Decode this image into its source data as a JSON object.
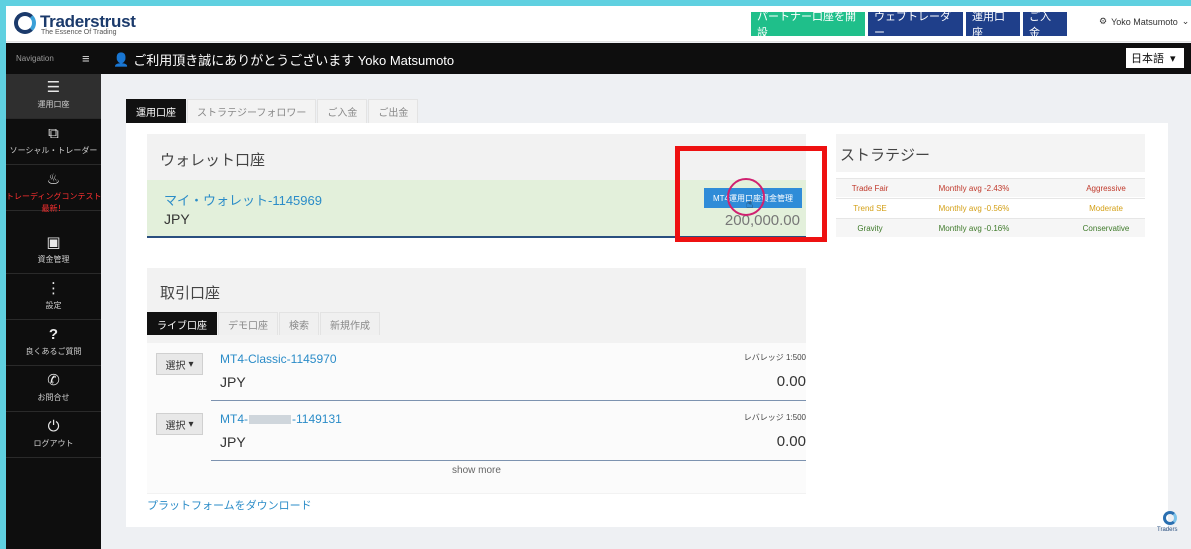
{
  "header": {
    "logo_name": "Traderstrust",
    "logo_tagline": "The Essence Of Trading",
    "buttons": {
      "partner": "パートナー口座を開設",
      "web_trader": "ウェブトレーダー",
      "accounts": "運用口座",
      "deposit": "ご入金"
    },
    "user_name": "Yoko Matsumoto"
  },
  "subbar": {
    "nav_label": "Navigation",
    "welcome": "ご利用頂き誠にありがとうございます Yoko Matsumoto",
    "language": "日本語"
  },
  "sidebar": {
    "items": [
      {
        "label": "運用口座",
        "icon": "server-icon"
      },
      {
        "label": "ソーシャル・トレーダー",
        "icon": "copy-icon"
      },
      {
        "label": "トレーディングコンテスト",
        "sub": "最新！",
        "icon": "cake-icon"
      },
      {
        "label": "資金管理",
        "icon": "money-icon"
      },
      {
        "label": "設定",
        "icon": "dots-icon"
      },
      {
        "label": "良くあるご質問",
        "icon": "question-icon"
      },
      {
        "label": "お問合せ",
        "icon": "phone-icon"
      },
      {
        "label": "ログアウト",
        "icon": "power-icon"
      }
    ]
  },
  "tabs": [
    "運用口座",
    "ストラテジーフォロワー",
    "ご入金",
    "ご出金"
  ],
  "wallet": {
    "section_title": "ウォレット口座",
    "name": "マイ・ウォレット-1145969",
    "currency": "JPY",
    "button": "MT4運用口座資金管理",
    "amount": "200,000.00"
  },
  "strategy": {
    "section_title": "ストラテジー",
    "rows": [
      {
        "name": "Trade Fair",
        "avg": "Monthly avg -2.43%",
        "risk": "Aggressive",
        "color": "#c0392b"
      },
      {
        "name": "Trend SE",
        "avg": "Monthly avg -0.56%",
        "risk": "Moderate",
        "color": "#d4a017"
      },
      {
        "name": "Gravity",
        "avg": "Monthly avg -0.16%",
        "risk": "Conservative",
        "color": "#3f7a2a"
      }
    ]
  },
  "trading": {
    "section_title": "取引口座",
    "tabs": [
      "ライブ口座",
      "デモ口座",
      "検索",
      "新規作成"
    ],
    "select_label": "選択",
    "leverage_label": "レバレッジ 1:500",
    "accounts": [
      {
        "name_prefix": "MT4-Classic-1145970",
        "name_suffix": "",
        "currency": "JPY",
        "amount": "0.00"
      },
      {
        "name_prefix": "MT4-",
        "name_suffix": "-1149131",
        "currency": "JPY",
        "amount": "0.00"
      }
    ],
    "show_more": "show more"
  },
  "download_link": "プラットフォームをダウンロード",
  "corner_logo_text": "Traders"
}
